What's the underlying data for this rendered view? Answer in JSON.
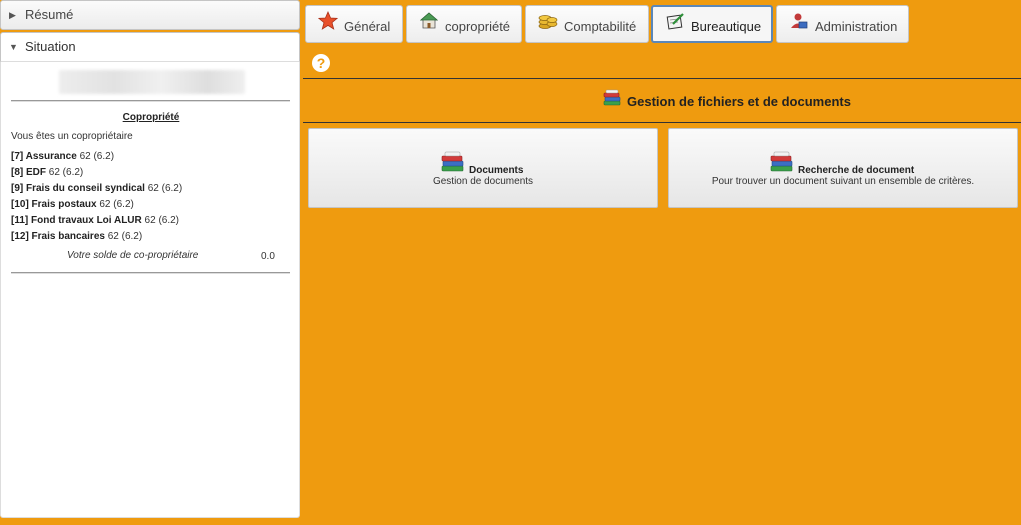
{
  "sidebar": {
    "resume_label": "Résumé",
    "situation_label": "Situation",
    "copro_title": "Copropriété",
    "vous_text": "Vous êtes un copropriétaire",
    "lines": [
      {
        "code": "[7] Assurance",
        "value": "62 (6.2)"
      },
      {
        "code": "[8] EDF",
        "value": "62 (6.2)"
      },
      {
        "code": "[9] Frais du conseil syndical",
        "value": "62 (6.2)"
      },
      {
        "code": "[10] Frais postaux",
        "value": "62 (6.2)"
      },
      {
        "code": "[11] Fond travaux Loi ALUR",
        "value": "62 (6.2)"
      },
      {
        "code": "[12] Frais bancaires",
        "value": "62 (6.2)"
      }
    ],
    "solde_label": "Votre solde de co-propriétaire",
    "solde_value": "0.0"
  },
  "tabs": [
    {
      "label": "Général",
      "icon": "star-icon"
    },
    {
      "label": "copropriété",
      "icon": "house-icon"
    },
    {
      "label": "Comptabilité",
      "icon": "coins-icon"
    },
    {
      "label": "Bureautique",
      "icon": "notepad-pen-icon",
      "active": true
    },
    {
      "label": "Administration",
      "icon": "admin-user-icon"
    }
  ],
  "help_glyph": "?",
  "section": {
    "title": "Gestion de fichiers et de documents",
    "icon": "books-icon"
  },
  "cards": [
    {
      "title": "Documents",
      "desc": "Gestion de documents",
      "icon": "books-icon"
    },
    {
      "title": "Recherche de document",
      "desc": "Pour trouver un document suivant un ensemble de critères.",
      "icon": "books-icon"
    }
  ],
  "colors": {
    "background": "#ef9b0f",
    "active_tab_border": "#5b87b8"
  }
}
